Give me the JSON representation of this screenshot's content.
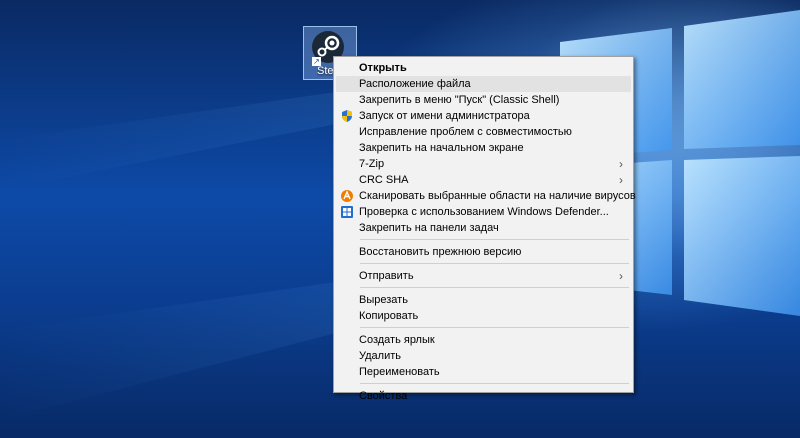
{
  "desktop": {
    "icon": {
      "label": "Steam",
      "icon": "steam-icon"
    }
  },
  "context_menu": {
    "items": [
      {
        "label": "Открыть",
        "bold": true
      },
      {
        "label": "Расположение файла",
        "highlighted": true
      },
      {
        "label": "Закрепить в меню \"Пуск\" (Classic Shell)"
      },
      {
        "label": "Запуск от имени администратора",
        "icon": "shield-icon"
      },
      {
        "label": "Исправление проблем с совместимостью"
      },
      {
        "label": "Закрепить на начальном экране"
      },
      {
        "label": "7-Zip",
        "submenu": true
      },
      {
        "label": "CRC SHA",
        "submenu": true
      },
      {
        "label": "Сканировать выбранные области на наличие вирусов",
        "icon": "avast-icon"
      },
      {
        "label": "Проверка с использованием Windows Defender...",
        "icon": "windows-defender-icon"
      },
      {
        "label": "Закрепить на панели задач"
      },
      {
        "label": "Восстановить прежнюю версию"
      },
      {
        "label": "Отправить",
        "submenu": true
      },
      {
        "label": "Вырезать"
      },
      {
        "label": "Копировать"
      },
      {
        "label": "Создать ярлык"
      },
      {
        "label": "Удалить"
      },
      {
        "label": "Переименовать"
      },
      {
        "label": "Свойства"
      }
    ],
    "annotation_color": "#e01414"
  }
}
